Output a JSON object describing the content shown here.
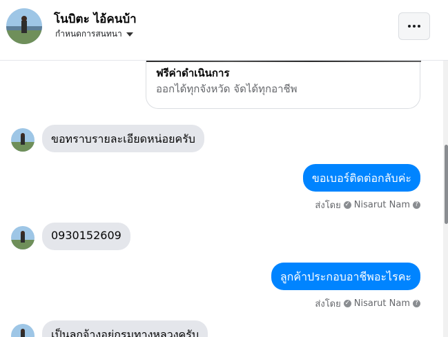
{
  "header": {
    "name": "โนบิตะ ไอ้คนบ้า",
    "subtitle": "กำหนดการสนทนา",
    "menu_icon": "more-icon"
  },
  "ad_card": {
    "title": "ฟรีค่าดำเนินการ",
    "description": "ออกได้ทุกจังหวัด จัดได้ทุกอาชีพ"
  },
  "messages": [
    {
      "direction": "in",
      "text": "ขอทราบรายละเอียดหน่อยครับ"
    },
    {
      "direction": "out",
      "text": "ขอเบอร์ติดต่อกลับค่ะ",
      "sent_by_label": "ส่งโดย",
      "sender": "Nisarut Nam"
    },
    {
      "direction": "in",
      "text": "0930152609"
    },
    {
      "direction": "out",
      "text": "ลูกค้าประกอบอาชีพอะไรคะ",
      "sent_by_label": "ส่งโดย",
      "sender": "Nisarut Nam"
    },
    {
      "direction": "in",
      "text": "เป็นลูกจ้างอยู่กรมทางหลวงครับ"
    }
  ],
  "colors": {
    "outgoing_bubble": "#0084ff",
    "incoming_bubble": "#e4e6eb"
  }
}
